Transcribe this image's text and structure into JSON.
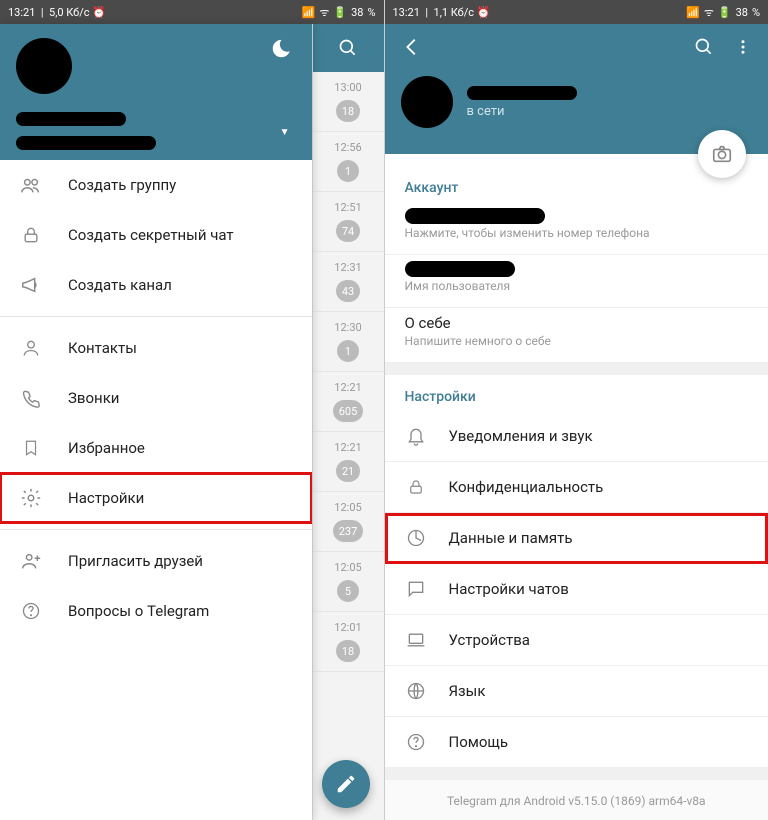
{
  "left": {
    "status": {
      "time": "13:21",
      "net": "5,0 Кб/c",
      "battery": "38"
    },
    "menu": {
      "items": [
        {
          "id": "create-group",
          "label": "Создать группу"
        },
        {
          "id": "create-secret",
          "label": "Создать секретный чат"
        },
        {
          "id": "create-channel",
          "label": "Создать канал"
        },
        {
          "id": "contacts",
          "label": "Контакты"
        },
        {
          "id": "calls",
          "label": "Звонки"
        },
        {
          "id": "saved",
          "label": "Избранное"
        },
        {
          "id": "settings",
          "label": "Настройки"
        },
        {
          "id": "invite",
          "label": "Пригласить друзей"
        },
        {
          "id": "faq",
          "label": "Вопросы о Telegram"
        }
      ]
    },
    "chats": [
      {
        "time": "13:00",
        "badge": "18"
      },
      {
        "time": "12:56",
        "badge": "1"
      },
      {
        "time": "12:51",
        "badge": "74"
      },
      {
        "time": "12:31",
        "badge": "43"
      },
      {
        "time": "12:30",
        "badge": "1"
      },
      {
        "time": "12:21",
        "badge": "605"
      },
      {
        "time": "12:21",
        "badge": "21"
      },
      {
        "time": "12:05",
        "badge": "237"
      },
      {
        "time": "12:05",
        "badge": "5"
      },
      {
        "time": "12:01",
        "badge": "18"
      }
    ]
  },
  "right": {
    "status": {
      "time": "13:21",
      "net": "1,1 Кб/c",
      "battery": "38"
    },
    "profile": {
      "online": "в сети"
    },
    "account": {
      "title": "Аккаунт",
      "phone_hint": "Нажмите, чтобы изменить номер телефона",
      "username_hint": "Имя пользователя",
      "about": "О себе",
      "about_hint": "Напишите немного о себе"
    },
    "settings": {
      "title": "Настройки",
      "items": [
        {
          "id": "notifications",
          "label": "Уведомления и звук"
        },
        {
          "id": "privacy",
          "label": "Конфиденциальность"
        },
        {
          "id": "data",
          "label": "Данные и память"
        },
        {
          "id": "chat-settings",
          "label": "Настройки чатов"
        },
        {
          "id": "devices",
          "label": "Устройства"
        },
        {
          "id": "language",
          "label": "Язык"
        },
        {
          "id": "help",
          "label": "Помощь"
        }
      ]
    },
    "version": "Telegram для Android v5.15.0 (1869) arm64-v8a"
  }
}
